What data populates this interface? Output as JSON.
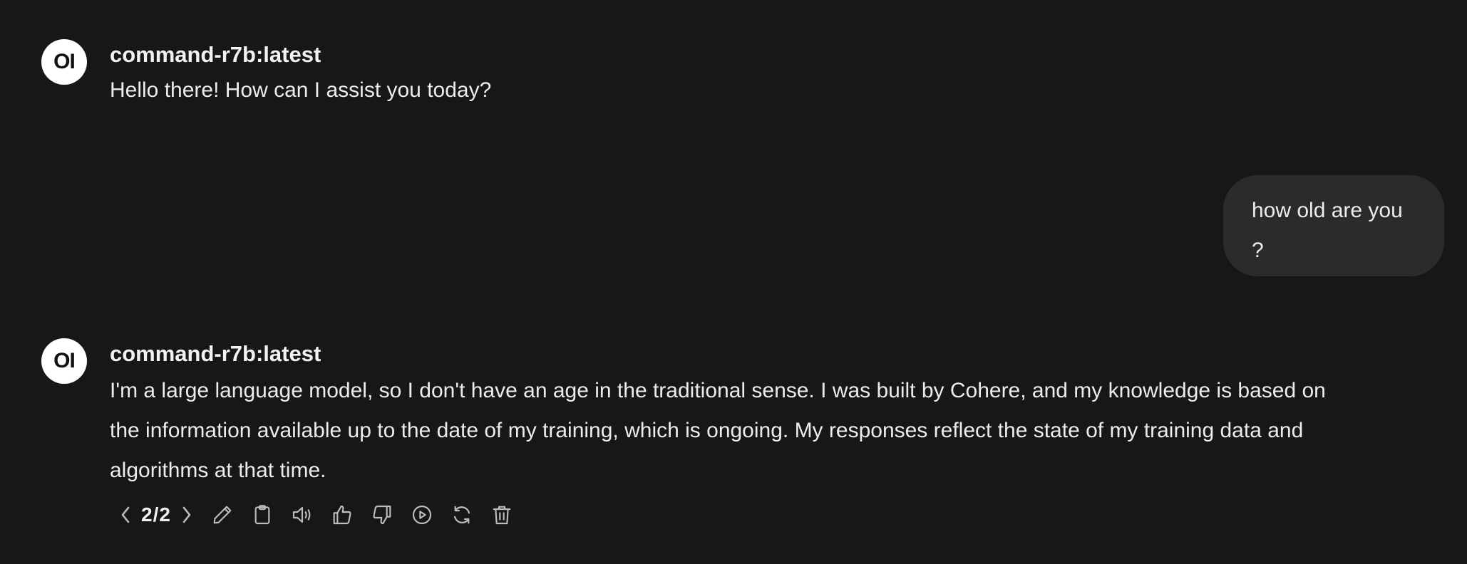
{
  "messages": [
    {
      "role": "assistant",
      "avatar": "OI",
      "model": "command-r7b:latest",
      "text": "Hello there! How can I assist you today?"
    },
    {
      "role": "user",
      "line1": "how old are you",
      "line2": "?"
    },
    {
      "role": "assistant",
      "avatar": "OI",
      "model": "command-r7b:latest",
      "line1": "I'm a large language model, so I don't have an age in the traditional sense. I was built by Cohere, and my knowledge is based on",
      "line2": "the information available up to the date of my training, which is ongoing. My responses reflect the state of my training data and",
      "line3": "algorithms at that time."
    }
  ],
  "actions": {
    "pager": "2/2",
    "icons": [
      "chevron-left-icon",
      "chevron-right-icon",
      "edit-icon",
      "copy-icon",
      "read-aloud-icon",
      "thumbs-up-icon",
      "thumbs-down-icon",
      "play-icon",
      "regenerate-icon",
      "delete-icon"
    ]
  },
  "colors": {
    "background": "#171717",
    "user_bubble": "#2b2b2b",
    "text": "#ececec",
    "icon": "#bdbdbd"
  }
}
